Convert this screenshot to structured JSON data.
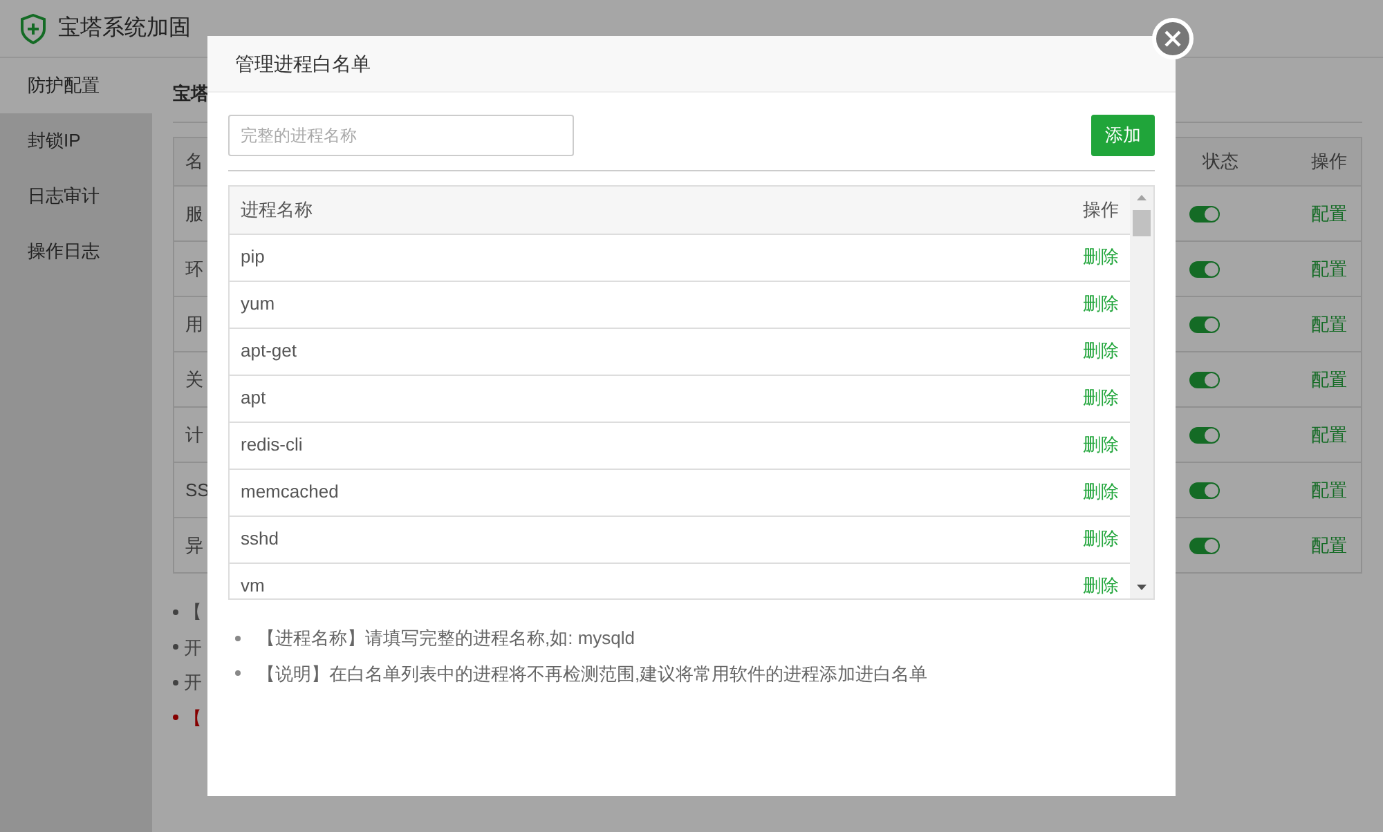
{
  "app": {
    "title": "宝塔系统加固"
  },
  "sidebar": {
    "items": [
      {
        "label": "防护配置",
        "selected": true
      },
      {
        "label": "封锁IP",
        "selected": false
      },
      {
        "label": "日志审计",
        "selected": false
      },
      {
        "label": "操作日志",
        "selected": false
      }
    ]
  },
  "main": {
    "heading": "宝塔",
    "table": {
      "columns": [
        "名",
        "状态",
        "操作"
      ],
      "rows": [
        {
          "name": "服",
          "on": true,
          "action": "配置"
        },
        {
          "name": "环",
          "on": true,
          "action": "配置"
        },
        {
          "name": "用",
          "on": true,
          "action": "配置"
        },
        {
          "name": "关",
          "on": true,
          "action": "配置"
        },
        {
          "name": "计",
          "on": true,
          "action": "配置"
        },
        {
          "name": "SS",
          "on": true,
          "action": "配置"
        },
        {
          "name": "异",
          "on": true,
          "action": "配置"
        }
      ]
    },
    "notes": [
      {
        "text": "【",
        "kind": "normal"
      },
      {
        "text": "开",
        "kind": "normal"
      },
      {
        "text": "开",
        "kind": "normal"
      },
      {
        "text": "【",
        "kind": "warning"
      }
    ]
  },
  "dialog": {
    "title": "管理进程白名单",
    "input": {
      "placeholder": "完整的进程名称"
    },
    "add_button": "添加",
    "table": {
      "columns": [
        "进程名称",
        "操作"
      ],
      "rows": [
        {
          "name": "pip",
          "action": "删除"
        },
        {
          "name": "yum",
          "action": "删除"
        },
        {
          "name": "apt-get",
          "action": "删除"
        },
        {
          "name": "apt",
          "action": "删除"
        },
        {
          "name": "redis-cli",
          "action": "删除"
        },
        {
          "name": "memcached",
          "action": "删除"
        },
        {
          "name": "sshd",
          "action": "删除"
        },
        {
          "name": "vm",
          "action": "删除"
        }
      ]
    },
    "notes": [
      "【进程名称】请填写完整的进程名称,如: mysqld",
      "【说明】在白名单列表中的进程将不再检测范围,建议将常用软件的进程添加进白名单"
    ]
  }
}
